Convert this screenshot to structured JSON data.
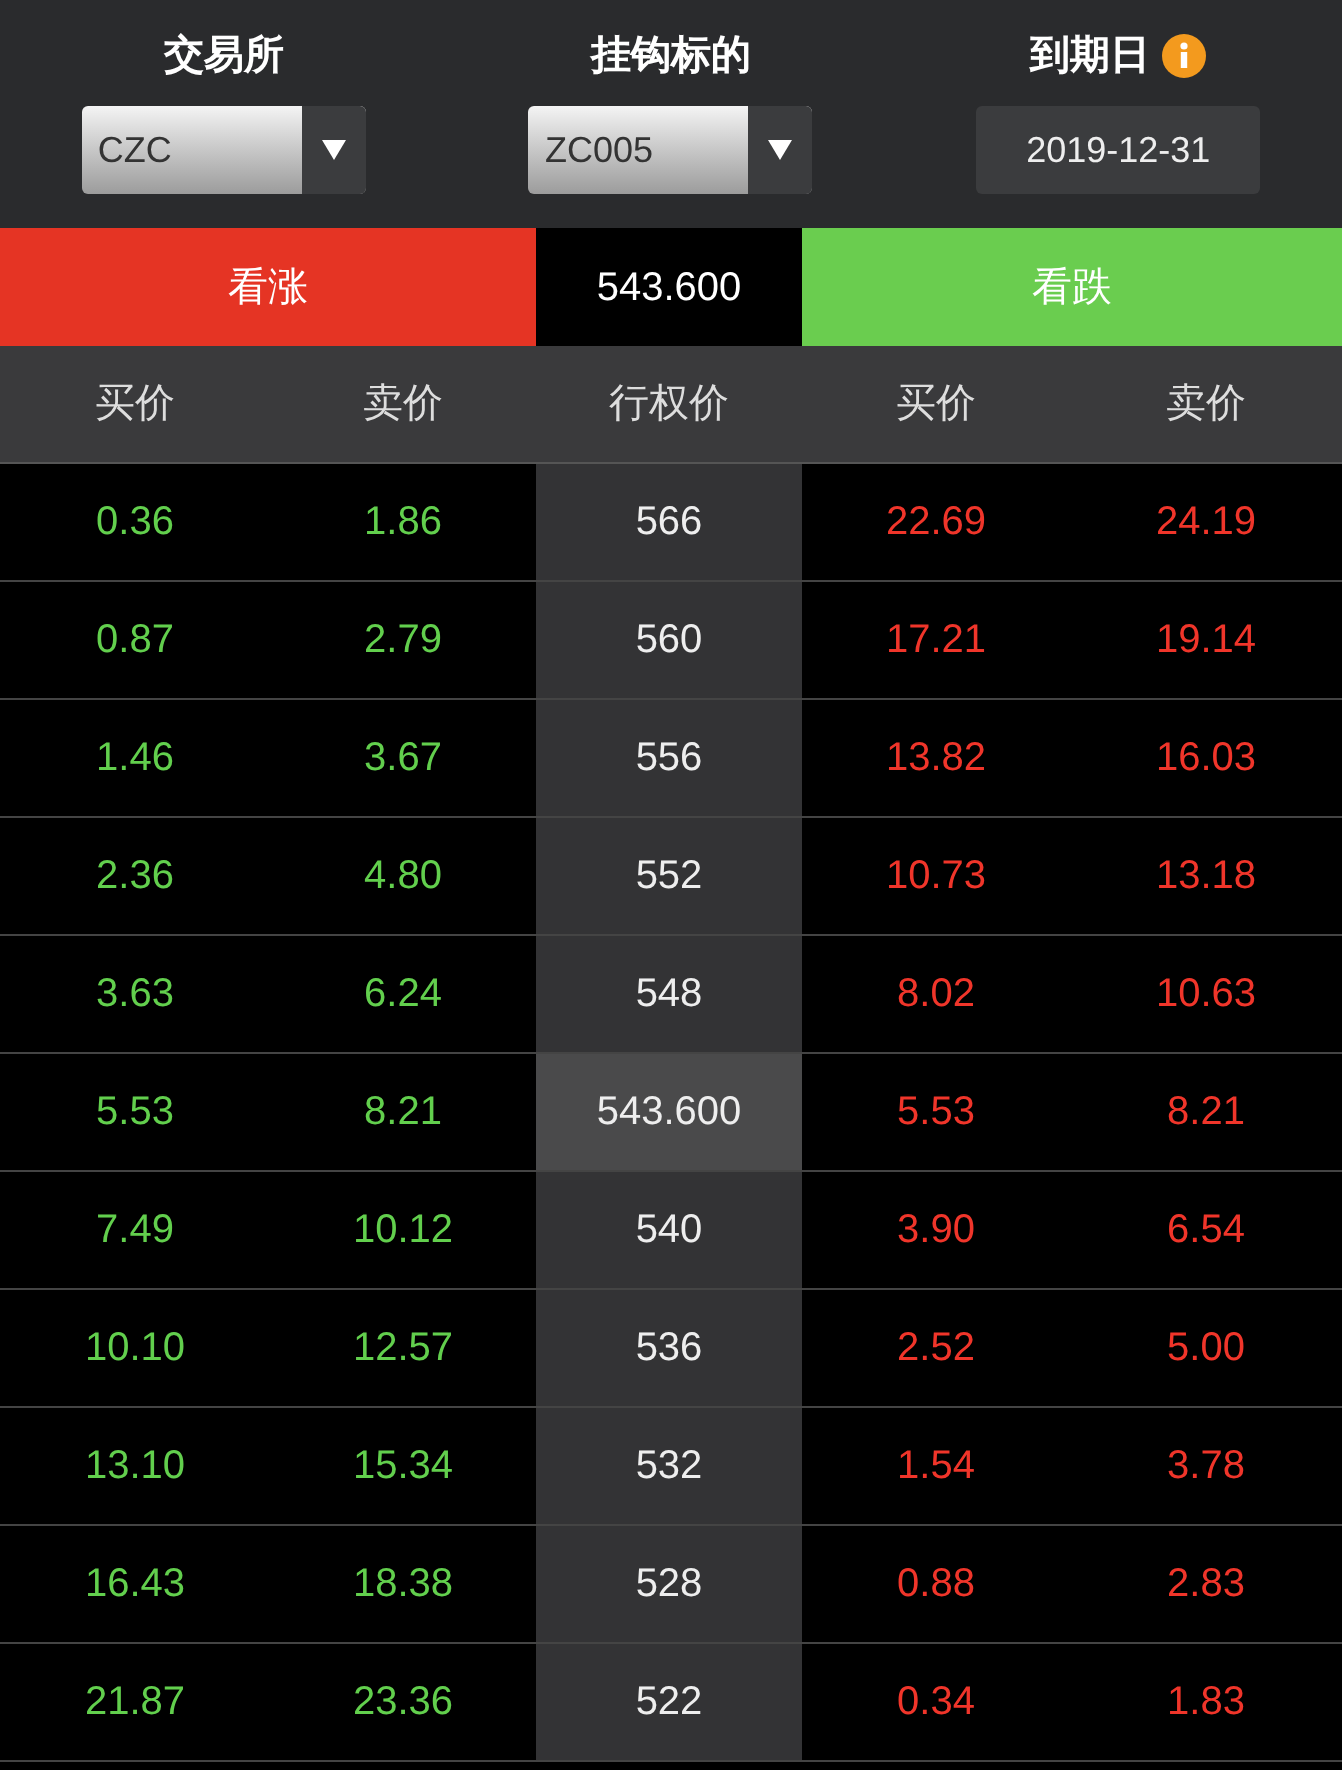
{
  "header": {
    "exchange": {
      "label": "交易所",
      "value": "CZC"
    },
    "underlying": {
      "label": "挂钩标的",
      "value": "ZC005"
    },
    "expiry": {
      "label": "到期日",
      "value": "2019-12-31"
    }
  },
  "price_bar": {
    "call_label": "看涨",
    "price": "543.600",
    "put_label": "看跌"
  },
  "columns": [
    "买价",
    "卖价",
    "行权价",
    "买价",
    "卖价"
  ],
  "rows": [
    {
      "call_bid": "0.36",
      "call_ask": "1.86",
      "strike": "566",
      "put_bid": "22.69",
      "put_ask": "24.19",
      "highlighted": false
    },
    {
      "call_bid": "0.87",
      "call_ask": "2.79",
      "strike": "560",
      "put_bid": "17.21",
      "put_ask": "19.14",
      "highlighted": false
    },
    {
      "call_bid": "1.46",
      "call_ask": "3.67",
      "strike": "556",
      "put_bid": "13.82",
      "put_ask": "16.03",
      "highlighted": false
    },
    {
      "call_bid": "2.36",
      "call_ask": "4.80",
      "strike": "552",
      "put_bid": "10.73",
      "put_ask": "13.18",
      "highlighted": false
    },
    {
      "call_bid": "3.63",
      "call_ask": "6.24",
      "strike": "548",
      "put_bid": "8.02",
      "put_ask": "10.63",
      "highlighted": false
    },
    {
      "call_bid": "5.53",
      "call_ask": "8.21",
      "strike": "543.600",
      "put_bid": "5.53",
      "put_ask": "8.21",
      "highlighted": true
    },
    {
      "call_bid": "7.49",
      "call_ask": "10.12",
      "strike": "540",
      "put_bid": "3.90",
      "put_ask": "6.54",
      "highlighted": false
    },
    {
      "call_bid": "10.10",
      "call_ask": "12.57",
      "strike": "536",
      "put_bid": "2.52",
      "put_ask": "5.00",
      "highlighted": false
    },
    {
      "call_bid": "13.10",
      "call_ask": "15.34",
      "strike": "532",
      "put_bid": "1.54",
      "put_ask": "3.78",
      "highlighted": false
    },
    {
      "call_bid": "16.43",
      "call_ask": "18.38",
      "strike": "528",
      "put_bid": "0.88",
      "put_ask": "2.83",
      "highlighted": false
    },
    {
      "call_bid": "21.87",
      "call_ask": "23.36",
      "strike": "522",
      "put_bid": "0.34",
      "put_ask": "1.83",
      "highlighted": false
    }
  ]
}
